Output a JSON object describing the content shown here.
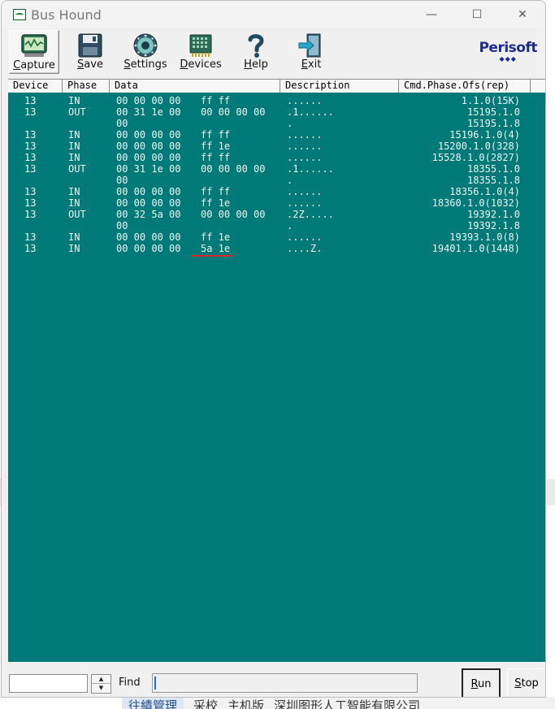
{
  "window": {
    "title": "Bus Hound"
  },
  "window_controls": {
    "minimize": "—",
    "maximize": "☐",
    "close": "✕"
  },
  "toolbar": {
    "items": [
      {
        "id": "capture",
        "first": "C",
        "rest": "apture",
        "icon": "capture-icon",
        "active": true
      },
      {
        "id": "save",
        "first": "S",
        "rest": "ave",
        "icon": "save-icon"
      },
      {
        "id": "settings",
        "first": "S",
        "rest": "ettings",
        "icon": "settings-icon"
      },
      {
        "id": "devices",
        "first": "D",
        "rest": "evices",
        "icon": "devices-icon"
      },
      {
        "id": "help",
        "first": "H",
        "rest": "elp",
        "icon": "help-icon"
      },
      {
        "id": "exit",
        "first": "E",
        "rest": "xit",
        "icon": "exit-icon"
      }
    ],
    "logo": {
      "name": "Perisoft",
      "dots": "◆◆◆"
    }
  },
  "columns": [
    "Device",
    "Phase",
    "Data",
    "Description",
    "Cmd.Phase.Ofs(rep)"
  ],
  "rows": [
    {
      "device": "13",
      "phase": "IN",
      "data1": "00 00 00 00",
      "data2": "ff ff",
      "desc": "......",
      "cmd": "1.1.0(15K)"
    },
    {
      "device": "13",
      "phase": "OUT",
      "data1": "00 31 1e 00",
      "data2": "00 00 00 00",
      "desc": ".1......",
      "cmd": "15195.1.0"
    },
    {
      "device": "",
      "phase": "",
      "data1": "00",
      "data2": "",
      "desc": ".",
      "cmd": "15195.1.8"
    },
    {
      "device": "13",
      "phase": "IN",
      "data1": "00 00 00 00",
      "data2": "ff ff",
      "desc": "......",
      "cmd": "15196.1.0(4)"
    },
    {
      "device": "13",
      "phase": "IN",
      "data1": "00 00 00 00",
      "data2": "ff 1e",
      "desc": "......",
      "cmd": "15200.1.0(328)"
    },
    {
      "device": "13",
      "phase": "IN",
      "data1": "00 00 00 00",
      "data2": "ff ff",
      "desc": "......",
      "cmd": "15528.1.0(2827)"
    },
    {
      "device": "13",
      "phase": "OUT",
      "data1": "00 31 1e 00",
      "data2": "00 00 00 00",
      "desc": ".1......",
      "cmd": "18355.1.0"
    },
    {
      "device": "",
      "phase": "",
      "data1": "00",
      "data2": "",
      "desc": ".",
      "cmd": "18355.1.8"
    },
    {
      "device": "13",
      "phase": "IN",
      "data1": "00 00 00 00",
      "data2": "ff ff",
      "desc": "......",
      "cmd": "18356.1.0(4)"
    },
    {
      "device": "13",
      "phase": "IN",
      "data1": "00 00 00 00",
      "data2": "ff 1e",
      "desc": "......",
      "cmd": "18360.1.0(1032)"
    },
    {
      "device": "13",
      "phase": "OUT",
      "data1": "00 32 5a 00",
      "data2": "00 00 00 00",
      "desc": ".2Z.....",
      "cmd": "19392.1.0"
    },
    {
      "device": "",
      "phase": "",
      "data1": "00",
      "data2": "",
      "desc": ".",
      "cmd": "19392.1.8"
    },
    {
      "device": "13",
      "phase": "IN",
      "data1": "00 00 00 00",
      "data2": "ff 1e",
      "desc": "......",
      "cmd": "19393.1.0(8)"
    },
    {
      "device": "13",
      "phase": "IN",
      "data1": "00 00 00 00",
      "data2": "5a 1e",
      "desc": "....Z.",
      "cmd": "19401.1.0(1448)",
      "highlight": true
    }
  ],
  "bottom": {
    "find_value": "",
    "find_label": "Find",
    "run_first": "R",
    "run_rest": "un",
    "stop_first": "S",
    "stop_rest": "top"
  },
  "background": {
    "taskbar_items": [
      "往績管理",
      "采校",
      "主机版",
      "深圳图形人工智能有限公司"
    ]
  },
  "colors": {
    "grid_bg": "#007a78",
    "grid_text": "#eef4f4",
    "highlight": "#d9232a",
    "logo": "#1c2b8f"
  }
}
